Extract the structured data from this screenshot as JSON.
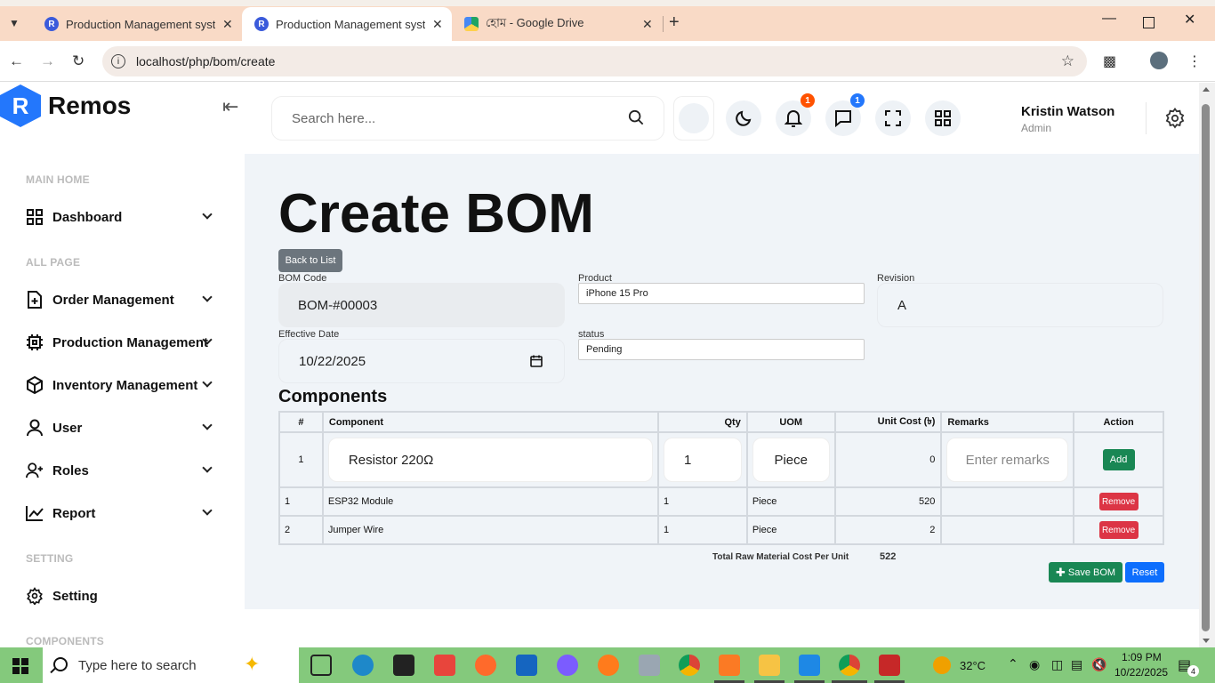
{
  "browser": {
    "tabs": [
      {
        "title": "Production Management system",
        "active": false
      },
      {
        "title": "Production Management system",
        "active": true
      },
      {
        "title": "হোম - Google Drive",
        "active": false
      }
    ],
    "url": "localhost/php/bom/create"
  },
  "sidebar": {
    "brand": "Remos",
    "sections": {
      "main_home": "MAIN HOME",
      "all_page": "ALL PAGE",
      "setting": "SETTING",
      "components": "COMPONENTS"
    },
    "items": {
      "dashboard": "Dashboard",
      "order": "Order Management",
      "production": "Production Management",
      "inventory": "Inventory Management",
      "user": "User",
      "roles": "Roles",
      "report": "Report",
      "setting": "Setting"
    }
  },
  "header": {
    "search_placeholder": "Search here...",
    "notifications_count": "1",
    "messages_count": "1",
    "user_name": "Kristin Watson",
    "user_role": "Admin"
  },
  "page": {
    "title": "Create BOM",
    "back_label": "Back to List",
    "fields": {
      "bom_code_label": "BOM Code",
      "bom_code_value": "BOM-#00003",
      "product_label": "Product",
      "product_value": "iPhone 15 Pro",
      "revision_label": "Revision",
      "revision_value": "A",
      "effective_date_label": "Effective Date",
      "effective_date_value": "10/22/2025",
      "status_label": "status",
      "status_value": "Pending"
    },
    "components_title": "Components",
    "table": {
      "headers": {
        "num": "#",
        "component": "Component",
        "qty": "Qty",
        "uom": "UOM",
        "unit_cost": "Unit Cost (৳)",
        "remarks": "Remarks",
        "action": "Action"
      },
      "input_row": {
        "num": "1",
        "component": "Resistor 220Ω",
        "qty": "1",
        "uom": "Piece",
        "unit_cost": "0",
        "remarks_placeholder": "Enter remarks",
        "action": "Add"
      },
      "rows": [
        {
          "num": "1",
          "component": "ESP32 Module",
          "qty": "1",
          "uom": "Piece",
          "unit_cost": "520",
          "remarks": "",
          "action": "Remove"
        },
        {
          "num": "2",
          "component": "Jumper Wire",
          "qty": "1",
          "uom": "Piece",
          "unit_cost": "2",
          "remarks": "",
          "action": "Remove"
        }
      ]
    },
    "total_label": "Total Raw Material Cost Per Unit",
    "total_value": "522",
    "save_label": "Save BOM",
    "reset_label": "Reset"
  },
  "taskbar": {
    "search_placeholder": "Type here to search",
    "weather": "32°C",
    "time": "1:09 PM",
    "date": "10/22/2025",
    "notif_count": "4"
  },
  "colors": {
    "brand_blue": "#2377fc",
    "save_green": "#198754",
    "reset_blue": "#0d6efd",
    "remove_red": "#dc3545",
    "badge_orange": "#ff5200",
    "badge_blue": "#2377fc"
  }
}
